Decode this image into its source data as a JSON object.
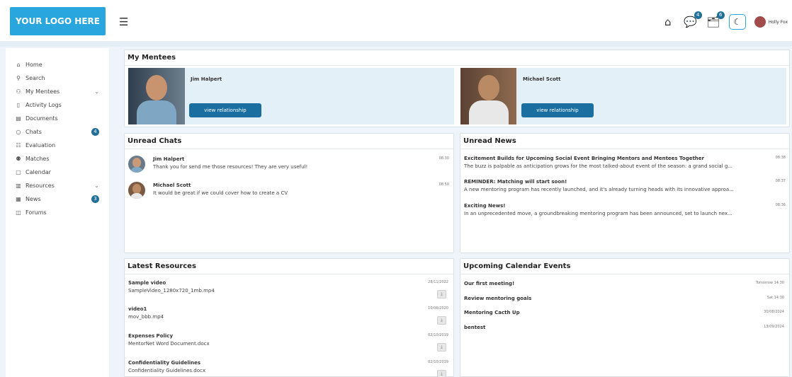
{
  "header": {
    "logo": "YOUR LOGO HERE",
    "menu_icon": "hamburger-icon",
    "icons": [
      "home-icon",
      "chat-icon",
      "notifications-icon",
      "theme-toggle-icon"
    ],
    "chat_badge": "4",
    "notification_badge": "6",
    "user_name": "Holly Fox"
  },
  "sidebar": {
    "items": [
      {
        "label": "Home",
        "icon": "home-icon"
      },
      {
        "label": "Search",
        "icon": "search-icon"
      },
      {
        "label": "My Mentees",
        "icon": "users-icon"
      },
      {
        "label": "Activity Logs",
        "icon": "activity-icon"
      },
      {
        "label": "Documents",
        "icon": "document-icon"
      },
      {
        "label": "Chats",
        "icon": "chat-icon",
        "badge": "4"
      },
      {
        "label": "Evaluation",
        "icon": "evaluation-icon"
      },
      {
        "label": "Matches",
        "icon": "matches-icon"
      },
      {
        "label": "Calendar",
        "icon": "calendar-icon"
      },
      {
        "label": "Resources",
        "icon": "resources-icon"
      },
      {
        "label": "News",
        "icon": "news-icon",
        "badge": "3"
      },
      {
        "label": "Forums",
        "icon": "forums-icon"
      }
    ]
  },
  "mentees": {
    "title": "My Mentees",
    "items": [
      {
        "name": "Jim Halpert",
        "button": "view relationship"
      },
      {
        "name": "Michael Scott",
        "button": "view relationship"
      }
    ]
  },
  "chats": {
    "title": "Unread Chats",
    "items": [
      {
        "name": "Jim Halpert",
        "message": "Thank you for send me those resources! They are very useful!",
        "time": "08:30"
      },
      {
        "name": "Michael Scott",
        "message": "It would be great if we could cover how to create a CV",
        "time": "08:50"
      }
    ]
  },
  "news": {
    "title": "Unread News",
    "items": [
      {
        "title": "Excitement Builds for Upcoming Social Event Bringing Mentors and Mentees Together",
        "text": "The buzz is palpable as anticipation grows for the most talked-about event of the season: a grand social g...",
        "time": "08:38"
      },
      {
        "title": "REMINDER: Matching will start soon!",
        "text": "A new mentoring program has recently launched, and it's already turning heads with its innovative approa...",
        "time": "08:37"
      },
      {
        "title": "Exciting News!",
        "text": "In an unprecedented move, a groundbreaking mentoring program has been announced, set to launch nex...",
        "time": "08:36"
      }
    ]
  },
  "resources": {
    "title": "Latest Resources",
    "items": [
      {
        "title": "Sample video",
        "file": "SampleVideo_1280x720_1mb.mp4",
        "date": "28/11/2022"
      },
      {
        "title": "video1",
        "file": "mov_bbb.mp4",
        "date": "10/06/2020"
      },
      {
        "title": "Expenses Policy",
        "file": "MentorNet Word Document.docx",
        "date": "02/10/2019"
      },
      {
        "title": "Confidentiality Guidelines",
        "file": "Confidentiality Guidelines.docx",
        "date": "02/10/2019"
      }
    ]
  },
  "events": {
    "title": "Upcoming Calendar Events",
    "items": [
      {
        "title": "Our first meeting!",
        "date": "Tomorrow 14:30"
      },
      {
        "title": "Review mentoring goals",
        "date": "Sat 14:30"
      },
      {
        "title": "Mentoring Cacth Up",
        "date": "30/08/2024"
      },
      {
        "title": "bentest",
        "date": "13/09/2024"
      }
    ]
  },
  "colors": {
    "accent": "#2aa6df",
    "button": "#1a6fa0",
    "badge": "#1f6f99",
    "card_bg": "#e3f0f7"
  }
}
